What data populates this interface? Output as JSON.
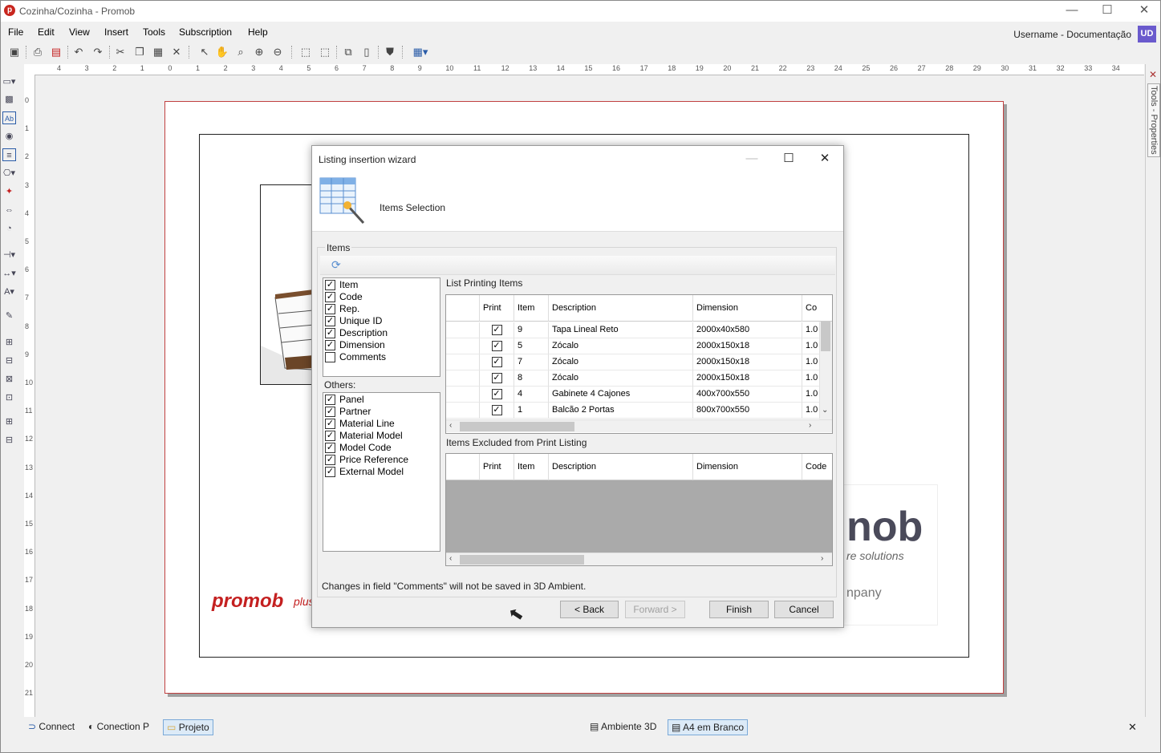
{
  "window": {
    "title": "Cozinha/Cozinha - Promob",
    "minimize": "—",
    "maximize": "☐",
    "close": "✕"
  },
  "menu": [
    "File",
    "Edit",
    "View",
    "Insert",
    "Tools",
    "Subscription",
    "Help"
  ],
  "user": {
    "name": "Username - Documentação",
    "initials": "UD"
  },
  "toolbar_icons": [
    "save-icon",
    "print-icon",
    "pdf-icon",
    "undo-icon",
    "redo-icon",
    "cut-icon",
    "copy-icon",
    "paste-icon",
    "delete-icon",
    "select-icon",
    "pan-icon",
    "zoom-icon",
    "zoom-in-icon",
    "zoom-out-icon",
    "frame-icon",
    "frame2-icon",
    "insert-icon",
    "page-icon",
    "paint-icon",
    "color-grid-icon"
  ],
  "ruler": {
    "h": [
      "4",
      "3",
      "2",
      "1",
      "0",
      "1",
      "2",
      "3",
      "4",
      "5",
      "6",
      "7",
      "8",
      "9",
      "10",
      "11",
      "12",
      "13",
      "14",
      "15",
      "16",
      "17",
      "18",
      "19",
      "20",
      "21",
      "22",
      "23",
      "24",
      "25",
      "26",
      "27",
      "28",
      "29",
      "30",
      "31",
      "32",
      "33",
      "34"
    ],
    "v": [
      "0",
      "1",
      "2",
      "3",
      "4",
      "5",
      "6",
      "7",
      "8",
      "9",
      "10",
      "11",
      "12",
      "13",
      "14",
      "15",
      "16",
      "17",
      "18",
      "19",
      "20",
      "21"
    ]
  },
  "right_panel": {
    "label": "Tools - Properties"
  },
  "page": {
    "logo_text": "promob",
    "logo_plus": "plus",
    "right_logo": {
      "big": "nob",
      "tag": "re solutions",
      "company": "npany"
    }
  },
  "dialog": {
    "title": "Listing insertion wizard",
    "step_title": "Items Selection",
    "group_label": "Items",
    "item_fields": [
      {
        "label": "Item",
        "checked": true
      },
      {
        "label": "Code",
        "checked": true
      },
      {
        "label": "Rep.",
        "checked": true
      },
      {
        "label": "Unique ID",
        "checked": true
      },
      {
        "label": "Description",
        "checked": true
      },
      {
        "label": "Dimension",
        "checked": true
      },
      {
        "label": "Comments",
        "checked": false
      }
    ],
    "others_label": "Others:",
    "other_fields": [
      {
        "label": "Panel",
        "checked": true
      },
      {
        "label": "Partner",
        "checked": true
      },
      {
        "label": "Material Line",
        "checked": true
      },
      {
        "label": "Material Model",
        "checked": true
      },
      {
        "label": "Model  Code",
        "checked": true
      },
      {
        "label": "Price Reference",
        "checked": true
      },
      {
        "label": "External Model",
        "checked": true
      }
    ],
    "list_printing_label": "List Printing Items",
    "printing_columns": [
      "Print",
      "Item",
      "Description",
      "Dimension",
      "Co"
    ],
    "printing_rows": [
      {
        "print": true,
        "item": "9",
        "description": "Tapa Lineal Reto",
        "dimension": "2000x40x580",
        "code": "1.0"
      },
      {
        "print": true,
        "item": "5",
        "description": "Zócalo",
        "dimension": "2000x150x18",
        "code": "1.0"
      },
      {
        "print": true,
        "item": "7",
        "description": "Zócalo",
        "dimension": "2000x150x18",
        "code": "1.0"
      },
      {
        "print": true,
        "item": "8",
        "description": "Zócalo",
        "dimension": "2000x150x18",
        "code": "1.0"
      },
      {
        "print": true,
        "item": "4",
        "description": "Gabinete 4 Cajones",
        "dimension": "400x700x550",
        "code": "1.0"
      },
      {
        "print": true,
        "item": "1",
        "description": "Balcão 2 Portas",
        "dimension": "800x700x550",
        "code": "1.0"
      }
    ],
    "excluded_label": "Items Excluded from Print Listing",
    "excluded_columns": [
      "Print",
      "Item",
      "Description",
      "Dimension",
      "Code"
    ],
    "note": "Changes in field \"Comments\" will not be saved in 3D Ambient.",
    "buttons": {
      "back": "< Back",
      "forward": "Forward >",
      "finish": "Finish",
      "cancel": "Cancel"
    }
  },
  "taskbar": {
    "left": [
      "Connect",
      "Conection P",
      "Projeto"
    ],
    "right": [
      "Ambiente 3D",
      "A4 em Branco"
    ],
    "close": "✕"
  }
}
